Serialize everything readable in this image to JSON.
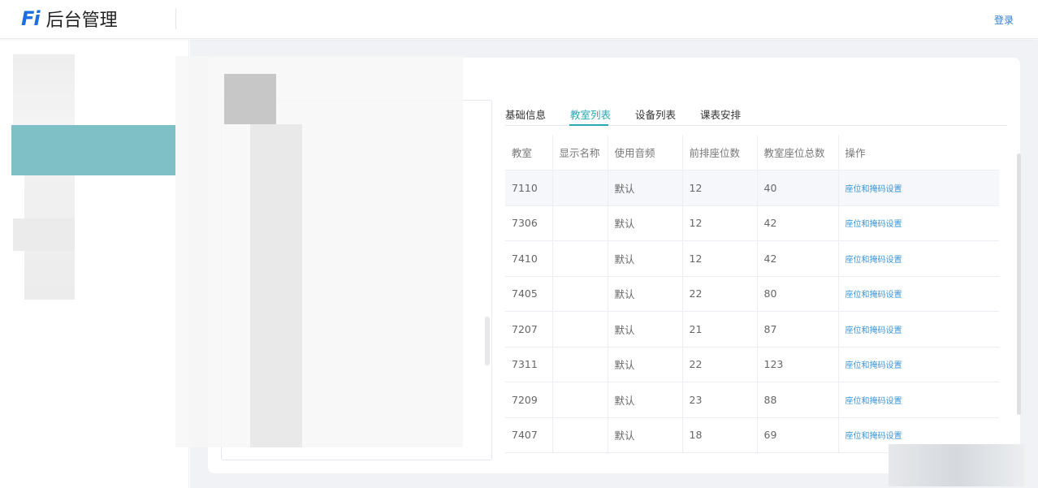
{
  "header": {
    "logo_mark": "Fi",
    "logo_title": "后台管理",
    "login_label": "登录"
  },
  "tabs": [
    {
      "label": "基础信息",
      "active": false
    },
    {
      "label": "教室列表",
      "active": true
    },
    {
      "label": "设备列表",
      "active": false
    },
    {
      "label": "课表安排",
      "active": false
    }
  ],
  "table": {
    "columns": [
      "教室",
      "显示名称",
      "使用音频",
      "前排座位数",
      "教室座位总数",
      "操作"
    ],
    "rows": [
      {
        "room": "7110",
        "display_name": "",
        "audio": "默认",
        "front_seats": "12",
        "total_seats": "40",
        "action": "座位和掩码设置"
      },
      {
        "room": "7306",
        "display_name": "",
        "audio": "默认",
        "front_seats": "12",
        "total_seats": "42",
        "action": "座位和掩码设置"
      },
      {
        "room": "7410",
        "display_name": "",
        "audio": "默认",
        "front_seats": "12",
        "total_seats": "42",
        "action": "座位和掩码设置"
      },
      {
        "room": "7405",
        "display_name": "",
        "audio": "默认",
        "front_seats": "22",
        "total_seats": "80",
        "action": "座位和掩码设置"
      },
      {
        "room": "7207",
        "display_name": "",
        "audio": "默认",
        "front_seats": "21",
        "total_seats": "87",
        "action": "座位和掩码设置"
      },
      {
        "room": "7311",
        "display_name": "",
        "audio": "默认",
        "front_seats": "22",
        "total_seats": "123",
        "action": "座位和掩码设置"
      },
      {
        "room": "7209",
        "display_name": "",
        "audio": "默认",
        "front_seats": "23",
        "total_seats": "88",
        "action": "座位和掩码设置"
      },
      {
        "room": "7407",
        "display_name": "",
        "audio": "默认",
        "front_seats": "18",
        "total_seats": "69",
        "action": "座位和掩码设置"
      }
    ]
  },
  "colors": {
    "brand": "#1d6fe0",
    "accent": "#2aa8b0",
    "link": "#3a95d8",
    "sidebar_active": "#7fbfc6"
  }
}
